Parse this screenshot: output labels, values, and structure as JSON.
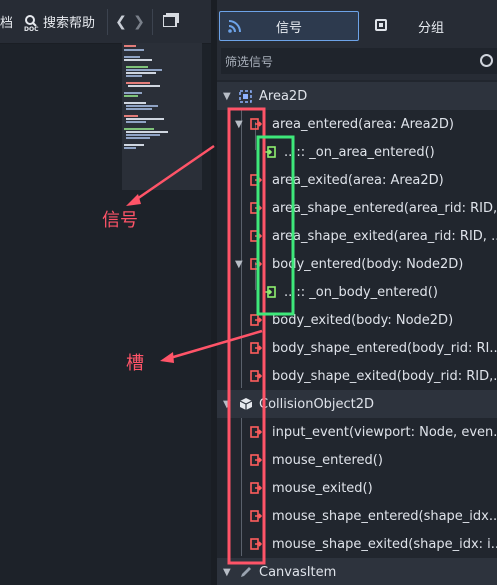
{
  "left_toolbar": {
    "doc_label": "档",
    "search_help_label": "搜索帮助",
    "nav_back": "❮",
    "nav_forward": "❯"
  },
  "dock": {
    "tabs": [
      {
        "label": "信号",
        "active": true
      },
      {
        "label": "分组",
        "active": false
      }
    ],
    "filter_placeholder": "筛选信号",
    "groups": [
      {
        "name": "Area2D",
        "icon": "area2d-icon",
        "signals": [
          {
            "label": "area_entered(area: Area2D)",
            "expanded": true,
            "connections": [
              ".. :: _on_area_entered()"
            ]
          },
          {
            "label": "area_exited(area: Area2D)"
          },
          {
            "label": "area_shape_entered(area_rid: RID,..."
          },
          {
            "label": "area_shape_exited(area_rid: RID, ..."
          },
          {
            "label": "body_entered(body: Node2D)",
            "expanded": true,
            "connections": [
              ".. :: _on_body_entered()"
            ]
          },
          {
            "label": "body_exited(body: Node2D)"
          },
          {
            "label": "body_shape_entered(body_rid: RI..."
          },
          {
            "label": "body_shape_exited(body_rid: RID,..."
          }
        ]
      },
      {
        "name": "CollisionObject2D",
        "icon": "cube-icon",
        "signals": [
          {
            "label": "input_event(viewport: Node, even..."
          },
          {
            "label": "mouse_entered()"
          },
          {
            "label": "mouse_exited()"
          },
          {
            "label": "mouse_shape_entered(shape_idx..."
          },
          {
            "label": "mouse_shape_exited(shape_idx: i..."
          }
        ]
      },
      {
        "name": "CanvasItem",
        "icon": "pencil-icon",
        "signals": []
      }
    ]
  },
  "annotations": {
    "signal_label": "信号",
    "slot_label": "槽",
    "signal_color": "#ff5468",
    "slot_color": "#3ee87a"
  },
  "colors": {
    "accent": "#6da3e8",
    "signal_icon": "#ff5d5d",
    "slot_icon": "#8ff070"
  }
}
